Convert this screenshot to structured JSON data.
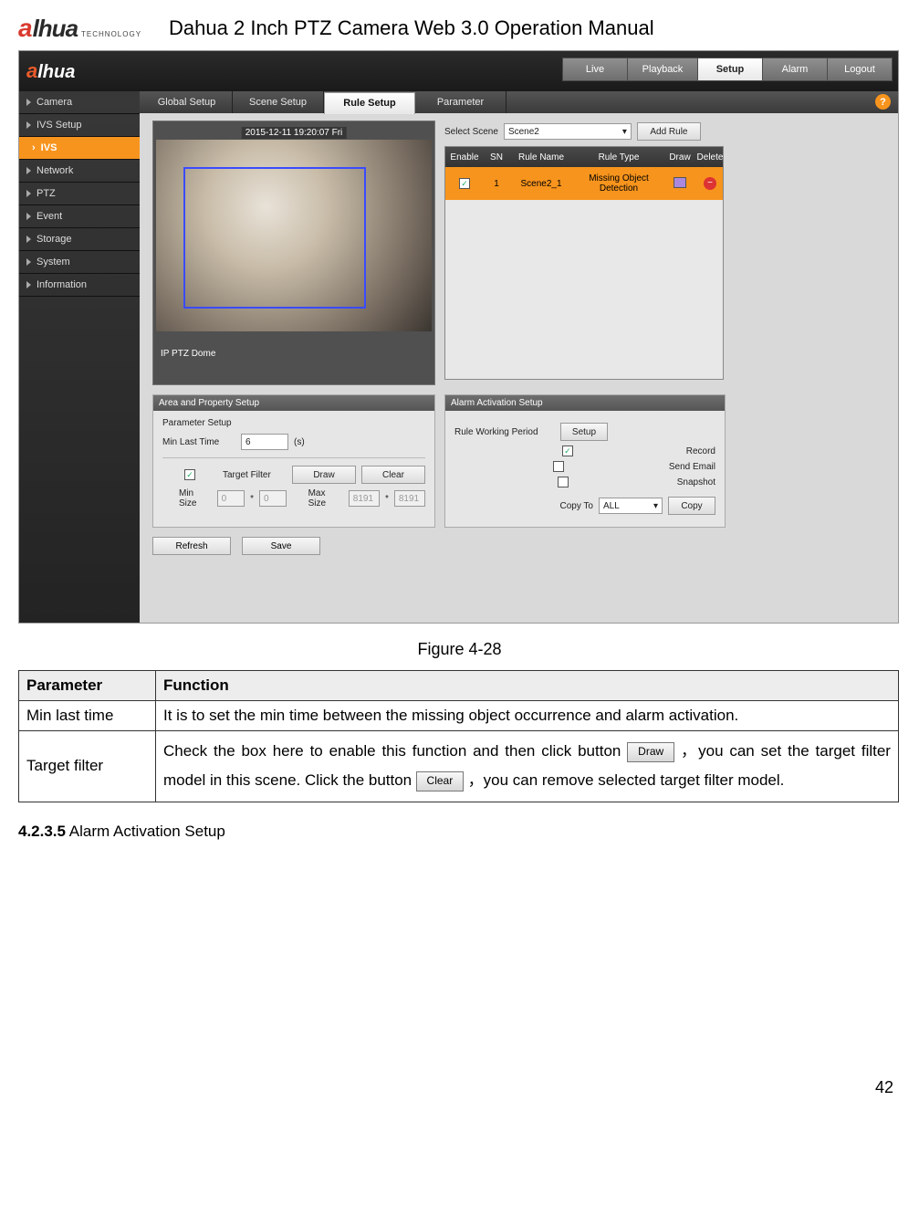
{
  "doc": {
    "logo_a": "a",
    "logo_rest": "lhua",
    "logo_sub": "TECHNOLOGY",
    "title": "Dahua 2 Inch PTZ Camera Web 3.0 Operation Manual"
  },
  "ss": {
    "logo_a": "a",
    "logo_rest": "lhua",
    "nav": {
      "live": "Live",
      "playback": "Playback",
      "setup": "Setup",
      "alarm": "Alarm",
      "logout": "Logout"
    },
    "sidebar": {
      "camera": "Camera",
      "ivs_setup": "IVS Setup",
      "ivs": "IVS",
      "network": "Network",
      "ptz": "PTZ",
      "event": "Event",
      "storage": "Storage",
      "system": "System",
      "information": "Information"
    },
    "subtabs": {
      "global": "Global Setup",
      "scene": "Scene Setup",
      "rule": "Rule Setup",
      "param": "Parameter"
    },
    "help": "?",
    "video": {
      "timestamp": "2015-12-11 19:20:07 Fri",
      "label": "IP PTZ Dome"
    },
    "rules": {
      "select_scene_label": "Select Scene",
      "select_scene_value": "Scene2",
      "add_rule": "Add Rule",
      "head": {
        "enable": "Enable",
        "sn": "SN",
        "name": "Rule Name",
        "type": "Rule Type",
        "draw": "Draw",
        "delete": "Delete"
      },
      "row": {
        "sn": "1",
        "name": "Scene2_1",
        "type": "Missing Object Detection"
      }
    },
    "area": {
      "title": "Area and Property Setup",
      "param_setup": "Parameter Setup",
      "min_last_label": "Min Last Time",
      "min_last_value": "6",
      "min_last_unit": "(s)",
      "target_filter": "Target Filter",
      "draw": "Draw",
      "clear": "Clear",
      "min_size": "Min Size",
      "max_size": "Max Size",
      "star": "*",
      "ms0a": "0",
      "ms0b": "0",
      "mx0a": "8191",
      "mx0b": "8191"
    },
    "alarm": {
      "title": "Alarm Activation Setup",
      "rule_working": "Rule Working Period",
      "setup": "Setup",
      "record": "Record",
      "send_email": "Send Email",
      "snapshot": "Snapshot",
      "copy_to": "Copy To",
      "all": "ALL",
      "copy": "Copy"
    },
    "buttons": {
      "refresh": "Refresh",
      "save": "Save"
    }
  },
  "figure_caption": "Figure 4-28",
  "param_table": {
    "h1": "Parameter",
    "h2": "Function",
    "r1": {
      "p": "Min last time",
      "f": "It is to set the min time between the missing object occurrence and alarm activation."
    },
    "r2": {
      "p": "Target filter",
      "f1": "Check the box here to enable this function and then click button ",
      "btn_draw": "Draw",
      "f2": "，you can set the target filter model in this scene. Click the button ",
      "btn_clear": "Clear",
      "f3": "，you can remove selected target filter model."
    }
  },
  "section": {
    "num": "4.2.3.5",
    "title": "Alarm Activation Setup"
  },
  "page_number": "42"
}
